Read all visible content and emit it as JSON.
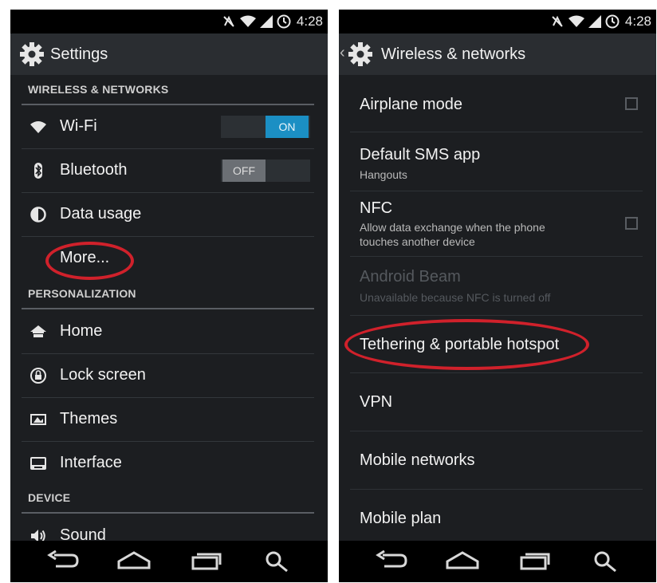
{
  "status": {
    "time": "4:28"
  },
  "left": {
    "title": "Settings",
    "sections": {
      "wireless": "WIRELESS & NETWORKS",
      "personalization": "PERSONALIZATION",
      "device": "DEVICE"
    },
    "items": {
      "wifi": "Wi-Fi",
      "bluetooth": "Bluetooth",
      "data_usage": "Data usage",
      "more": "More...",
      "home": "Home",
      "lock_screen": "Lock screen",
      "themes": "Themes",
      "interface": "Interface",
      "sound": "Sound"
    },
    "wifi_switch": {
      "state": "ON"
    },
    "bluetooth_switch": {
      "state": "OFF"
    }
  },
  "right": {
    "title": "Wireless & networks",
    "items": {
      "airplane": {
        "title": "Airplane mode"
      },
      "sms": {
        "title": "Default SMS app",
        "subtitle": "Hangouts"
      },
      "nfc": {
        "title": "NFC",
        "subtitle_line1": "Allow data exchange when the phone",
        "subtitle_line2": "touches another device"
      },
      "beam": {
        "title": "Android Beam",
        "subtitle": "Unavailable because NFC is turned off"
      },
      "tethering": {
        "title": "Tethering & portable hotspot"
      },
      "vpn": {
        "title": "VPN"
      },
      "mobile_networks": {
        "title": "Mobile networks"
      },
      "mobile_plan": {
        "title": "Mobile plan"
      }
    }
  },
  "colors": {
    "switch_on": "#1b8fc4",
    "switch_off": "#6b6f74",
    "highlight": "#d0212b"
  },
  "icons": [
    "sync-off-icon",
    "wifi-icon",
    "signal-icon",
    "battery-icon",
    "settings-gear-icon",
    "bluetooth-icon",
    "data-usage-icon",
    "home-icon",
    "lock-icon",
    "themes-icon",
    "interface-icon",
    "sound-icon",
    "back-icon",
    "home-nav-icon",
    "recents-icon",
    "search-icon"
  ]
}
